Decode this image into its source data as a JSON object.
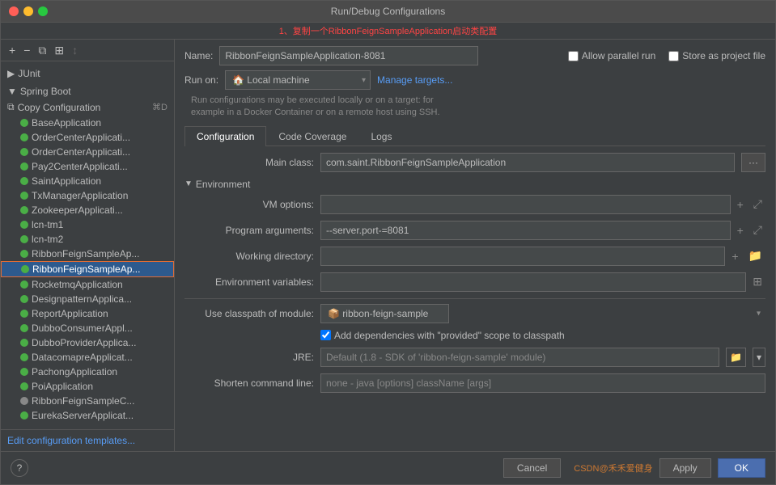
{
  "title": "Run/Debug Configurations",
  "annotation": "1、复制一个RibbonFeignSampleApplication启动类配置",
  "window_controls": {
    "close": "close",
    "minimize": "minimize",
    "maximize": "maximize"
  },
  "toolbar": {
    "add": "+",
    "remove": "−",
    "copy": "⧉",
    "folder": "📁"
  },
  "sidebar": {
    "junit_label": "JUnit",
    "spring_label": "Spring Boot",
    "copy_config_label": "Copy Configuration",
    "copy_config_shortcut": "⌘D",
    "items": [
      "BaseApplication",
      "OrderCenterApplicati...",
      "OrderCenterApplicati...",
      "Pay2CenterApplicati...",
      "SaintApplication",
      "TxManagerApplication",
      "ZookeeperApplicati...",
      "lcn-tm1",
      "lcn-tm2",
      "RibbonFeignSampleAp...",
      "RibbonFeignSampleAp...",
      "RocketmqApplication",
      "DesignpatternApplica...",
      "ReportApplication",
      "DubboConsumerAppl...",
      "DubboProviderApplica...",
      "DatacomapreApplicat...",
      "PachongApplication",
      "PoiApplication",
      "RibbonFeignSampleC...",
      "EurekaServerApplicat..."
    ],
    "edit_templates": "Edit configuration templates..."
  },
  "form": {
    "name_label": "Name:",
    "name_value": "RibbonFeignSampleApplication-8081",
    "allow_parallel_label": "Allow parallel run",
    "store_as_project_label": "Store as project file",
    "run_on_label": "Run on:",
    "local_machine": "🏠 Local machine",
    "manage_targets": "Manage targets...",
    "info_text": "Run configurations may be executed locally or on a target: for\nexample in a Docker Container or on a remote host using SSH."
  },
  "tabs": {
    "configuration": "Configuration",
    "code_coverage": "Code Coverage",
    "logs": "Logs"
  },
  "config": {
    "main_class_label": "Main class:",
    "main_class_value": "com.saint.RibbonFeignSampleApplication",
    "environment_label": "Environment",
    "vm_options_label": "VM options:",
    "vm_options_value": "",
    "program_args_label": "Program arguments:",
    "program_args_value": "--server.port-=8081",
    "working_dir_label": "Working directory:",
    "working_dir_value": "",
    "env_vars_label": "Environment variables:",
    "env_vars_value": "",
    "classpath_label": "Use classpath of module:",
    "classpath_value": "ribbon-feign-sample",
    "add_deps_label": "Add dependencies with \"provided\" scope to classpath",
    "jre_label": "JRE:",
    "jre_value": "Default (1.8 - SDK of 'ribbon-feign-sample' module)",
    "shorten_label": "Shorten command line:",
    "shorten_value": "none - java [options] className [args]"
  },
  "bottom": {
    "help": "?",
    "cancel": "Cancel",
    "apply": "Apply",
    "ok": "OK",
    "watermark": "CSDN@禾禾爱健身"
  }
}
